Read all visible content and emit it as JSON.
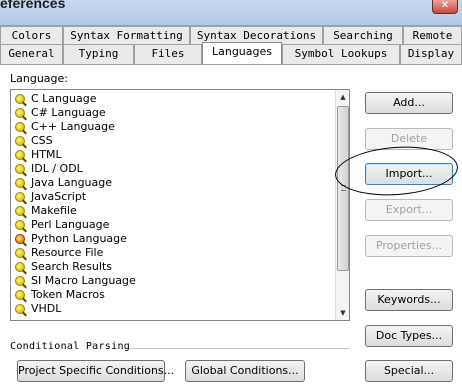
{
  "window": {
    "title": "eferences",
    "close_glyph": "✕"
  },
  "tabs_row1": [
    "Colors",
    "Syntax Formatting",
    "Syntax Decorations",
    "Searching",
    "Remote"
  ],
  "tabs_row2": [
    "General",
    "Typing",
    "Files",
    "Languages",
    "Symbol Lookups",
    "Display"
  ],
  "active_tab": "Languages",
  "language_label": "Language:",
  "languages": [
    {
      "name": "C Language",
      "icon": "magnifier-icon"
    },
    {
      "name": "C# Language",
      "icon": "magnifier-icon"
    },
    {
      "name": "C++ Language",
      "icon": "magnifier-icon"
    },
    {
      "name": "CSS",
      "icon": "magnifier-icon"
    },
    {
      "name": "HTML",
      "icon": "magnifier-icon"
    },
    {
      "name": "IDL / ODL",
      "icon": "magnifier-icon"
    },
    {
      "name": "Java Language",
      "icon": "magnifier-icon"
    },
    {
      "name": "JavaScript",
      "icon": "magnifier-icon"
    },
    {
      "name": "Makefile",
      "icon": "magnifier-icon"
    },
    {
      "name": "Perl Language",
      "icon": "magnifier-icon"
    },
    {
      "name": "Python Language",
      "icon": "magnifier-icon-red"
    },
    {
      "name": "Resource File",
      "icon": "magnifier-icon"
    },
    {
      "name": "Search Results",
      "icon": "magnifier-icon"
    },
    {
      "name": "SI Macro Language",
      "icon": "magnifier-icon"
    },
    {
      "name": "Token Macros",
      "icon": "magnifier-icon"
    },
    {
      "name": "VHDL",
      "icon": "magnifier-icon"
    }
  ],
  "buttons": {
    "add": "Add...",
    "delete": "Delete",
    "import": "Import...",
    "export": "Export...",
    "properties": "Properties...",
    "keywords": "Keywords...",
    "doc_types": "Doc Types...",
    "special": "Special..."
  },
  "conditional_parsing": {
    "label": "Conditional Parsing",
    "project_button": "Project Specific Conditions...",
    "global_button": "Global Conditions..."
  },
  "scrollbar": {
    "up_glyph": "▲",
    "down_glyph": "▼"
  }
}
